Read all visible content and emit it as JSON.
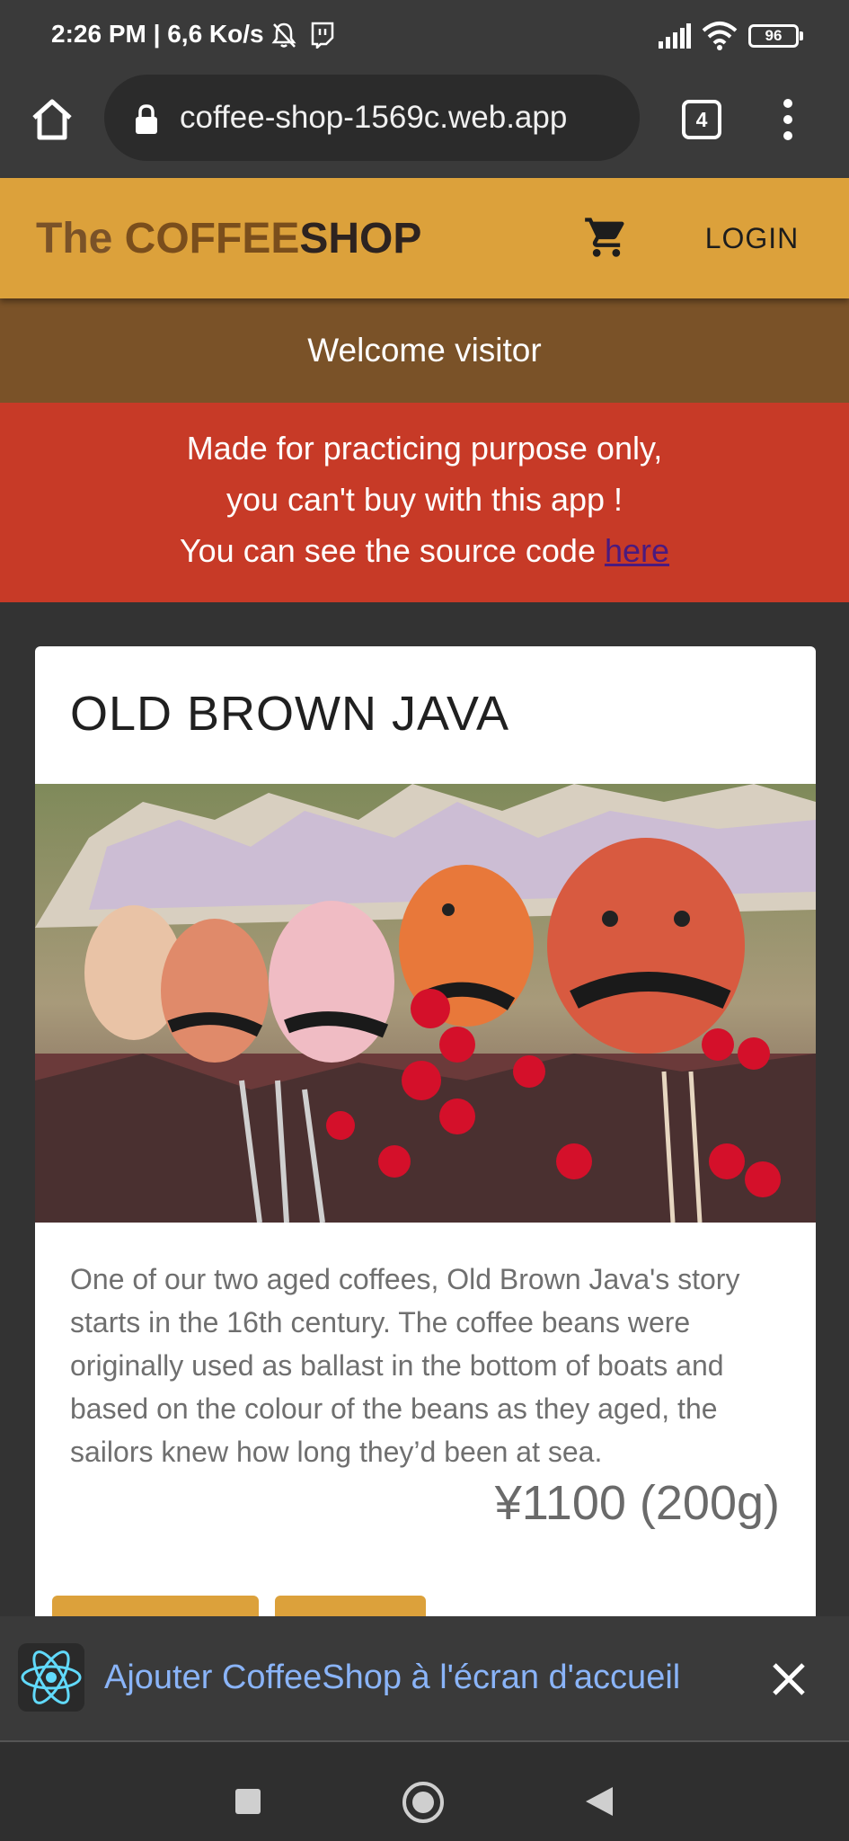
{
  "status_bar": {
    "time": "2:26 PM | 6,6 Ko/s",
    "battery": "96"
  },
  "browser": {
    "url": "coffee-shop-1569c.web.app",
    "tab_count": "4"
  },
  "header": {
    "brand_the": "The ",
    "brand_coffee": "COFFEE",
    "brand_shop": "SHOP",
    "login_label": "LOGIN"
  },
  "welcome": {
    "text": "Welcome visitor"
  },
  "notice": {
    "line1": "Made for practicing purpose only,",
    "line2": "you can't buy with this app !",
    "line3": "You can see the source code ",
    "link_label": "here"
  },
  "product": {
    "title": "OLD BROWN JAVA",
    "description": "One of our two aged coffees, Old Brown Java's story starts in the 16th century. The coffee beans were originally used as ballast in the bottom of boats and based on the colour of the beans as they aged, the sailors knew how long they’d been at sea.",
    "price": "¥1100 (200g)"
  },
  "install_banner": {
    "text": "Ajouter CoffeeShop à l'écran d'accueil"
  },
  "colors": {
    "header_bg": "#dca13b",
    "welcome_bg": "#7a5228",
    "notice_bg": "#c73a27",
    "link": "#4b1a7e",
    "banner_text": "#8ab4f8"
  },
  "icons": [
    "bell-muted-icon",
    "twitch-icon",
    "signal-icon",
    "wifi-icon",
    "battery-icon",
    "home-icon",
    "lock-icon",
    "tabs-icon",
    "more-vert-icon",
    "cart-icon",
    "react-icon",
    "close-icon",
    "nav-recents-icon",
    "nav-home-icon",
    "nav-back-icon"
  ]
}
